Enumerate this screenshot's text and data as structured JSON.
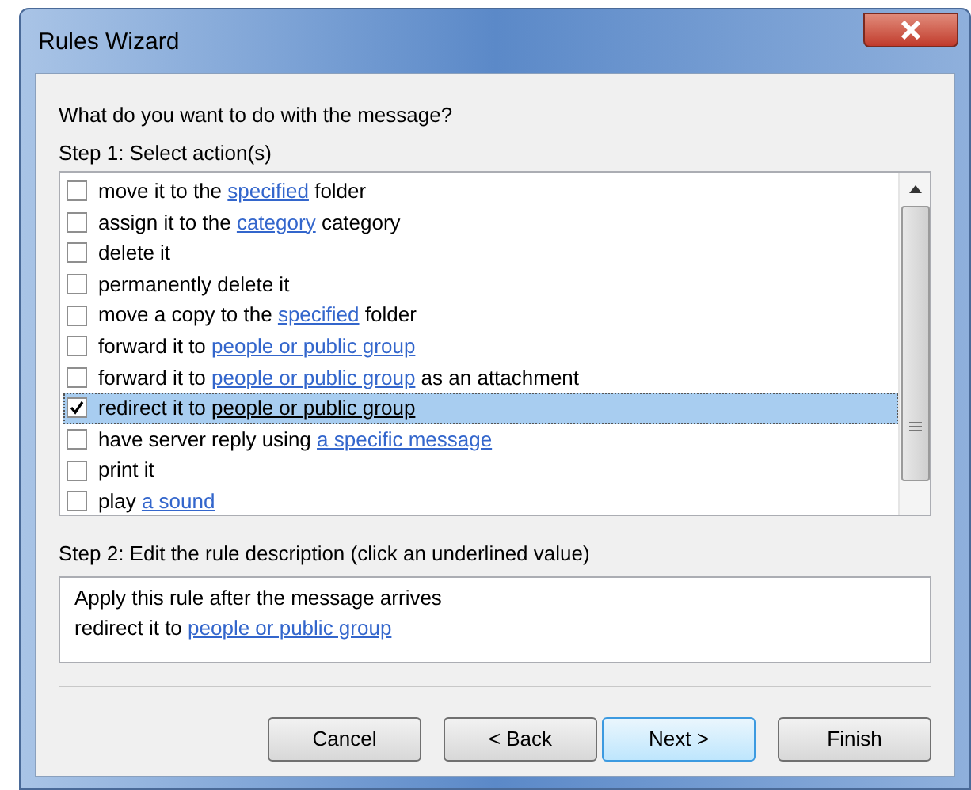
{
  "window": {
    "title": "Rules Wizard"
  },
  "prompt": "What do you want to do with the message?",
  "step1_label": "Step 1: Select action(s)",
  "actions": [
    {
      "checked": false,
      "selected": false,
      "parts": [
        {
          "kind": "text",
          "text": "move it to the "
        },
        {
          "kind": "link",
          "text": "specified"
        },
        {
          "kind": "text",
          "text": " folder"
        }
      ]
    },
    {
      "checked": false,
      "selected": false,
      "parts": [
        {
          "kind": "text",
          "text": "assign it to the "
        },
        {
          "kind": "link",
          "text": "category"
        },
        {
          "kind": "text",
          "text": " category"
        }
      ]
    },
    {
      "checked": false,
      "selected": false,
      "parts": [
        {
          "kind": "text",
          "text": "delete it"
        }
      ]
    },
    {
      "checked": false,
      "selected": false,
      "parts": [
        {
          "kind": "text",
          "text": "permanently delete it"
        }
      ]
    },
    {
      "checked": false,
      "selected": false,
      "parts": [
        {
          "kind": "text",
          "text": "move a copy to the "
        },
        {
          "kind": "link",
          "text": "specified"
        },
        {
          "kind": "text",
          "text": " folder"
        }
      ]
    },
    {
      "checked": false,
      "selected": false,
      "parts": [
        {
          "kind": "text",
          "text": "forward it to "
        },
        {
          "kind": "link",
          "text": "people or public group"
        }
      ]
    },
    {
      "checked": false,
      "selected": false,
      "parts": [
        {
          "kind": "text",
          "text": "forward it to "
        },
        {
          "kind": "link",
          "text": "people or public group"
        },
        {
          "kind": "text",
          "text": " as an attachment"
        }
      ]
    },
    {
      "checked": true,
      "selected": true,
      "parts": [
        {
          "kind": "text",
          "text": "redirect it to "
        },
        {
          "kind": "link",
          "text": "people or public group"
        }
      ]
    },
    {
      "checked": false,
      "selected": false,
      "parts": [
        {
          "kind": "text",
          "text": "have server reply using "
        },
        {
          "kind": "link",
          "text": "a specific message"
        }
      ]
    },
    {
      "checked": false,
      "selected": false,
      "parts": [
        {
          "kind": "text",
          "text": "print it"
        }
      ]
    },
    {
      "checked": false,
      "selected": false,
      "parts": [
        {
          "kind": "text",
          "text": "play "
        },
        {
          "kind": "link",
          "text": "a sound"
        }
      ]
    }
  ],
  "step2_label": "Step 2: Edit the rule description (click an underlined value)",
  "description": [
    {
      "parts": [
        {
          "kind": "text",
          "text": "Apply this rule after the message arrives"
        }
      ]
    },
    {
      "parts": [
        {
          "kind": "text",
          "text": "redirect it to "
        },
        {
          "kind": "link",
          "text": "people or public group"
        }
      ]
    }
  ],
  "buttons": [
    {
      "label": "Cancel",
      "default": false
    },
    {
      "label": "< Back",
      "default": false
    },
    {
      "label": "Next >",
      "default": true
    },
    {
      "label": "Finish",
      "default": false
    }
  ]
}
